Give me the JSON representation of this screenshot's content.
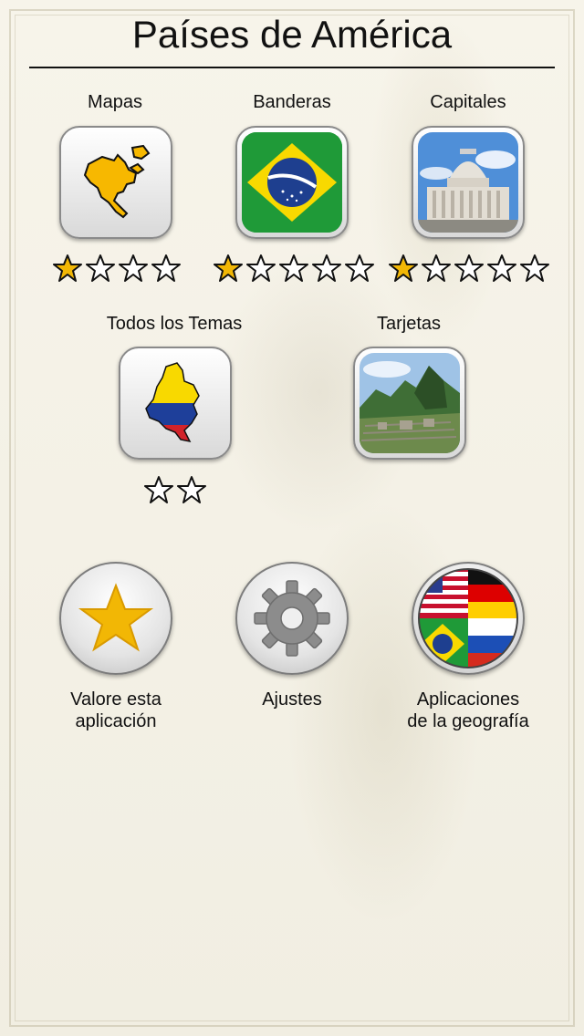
{
  "title": "Países de América",
  "tiles": {
    "mapas": {
      "label": "Mapas",
      "stars_total": 4,
      "stars_filled": 1
    },
    "banderas": {
      "label": "Banderas",
      "stars_total": 5,
      "stars_filled": 1
    },
    "capitales": {
      "label": "Capitales",
      "stars_total": 5,
      "stars_filled": 1
    },
    "todos": {
      "label": "Todos los Temas",
      "stars_total": 2,
      "stars_filled": 0
    },
    "tarjetas": {
      "label": "Tarjetas"
    }
  },
  "buttons": {
    "rate": {
      "line1": "Valore esta",
      "line2": "aplicación"
    },
    "settings": {
      "label": "Ajustes"
    },
    "apps": {
      "line1": "Aplicaciones",
      "line2": "de la geografía"
    }
  },
  "colors": {
    "star_fill": "#f2b705",
    "map_yellow": "#f7b800",
    "brazil_green": "#1f9a38",
    "brazil_yellow": "#f8d900",
    "brazil_blue": "#1e3f8f"
  }
}
